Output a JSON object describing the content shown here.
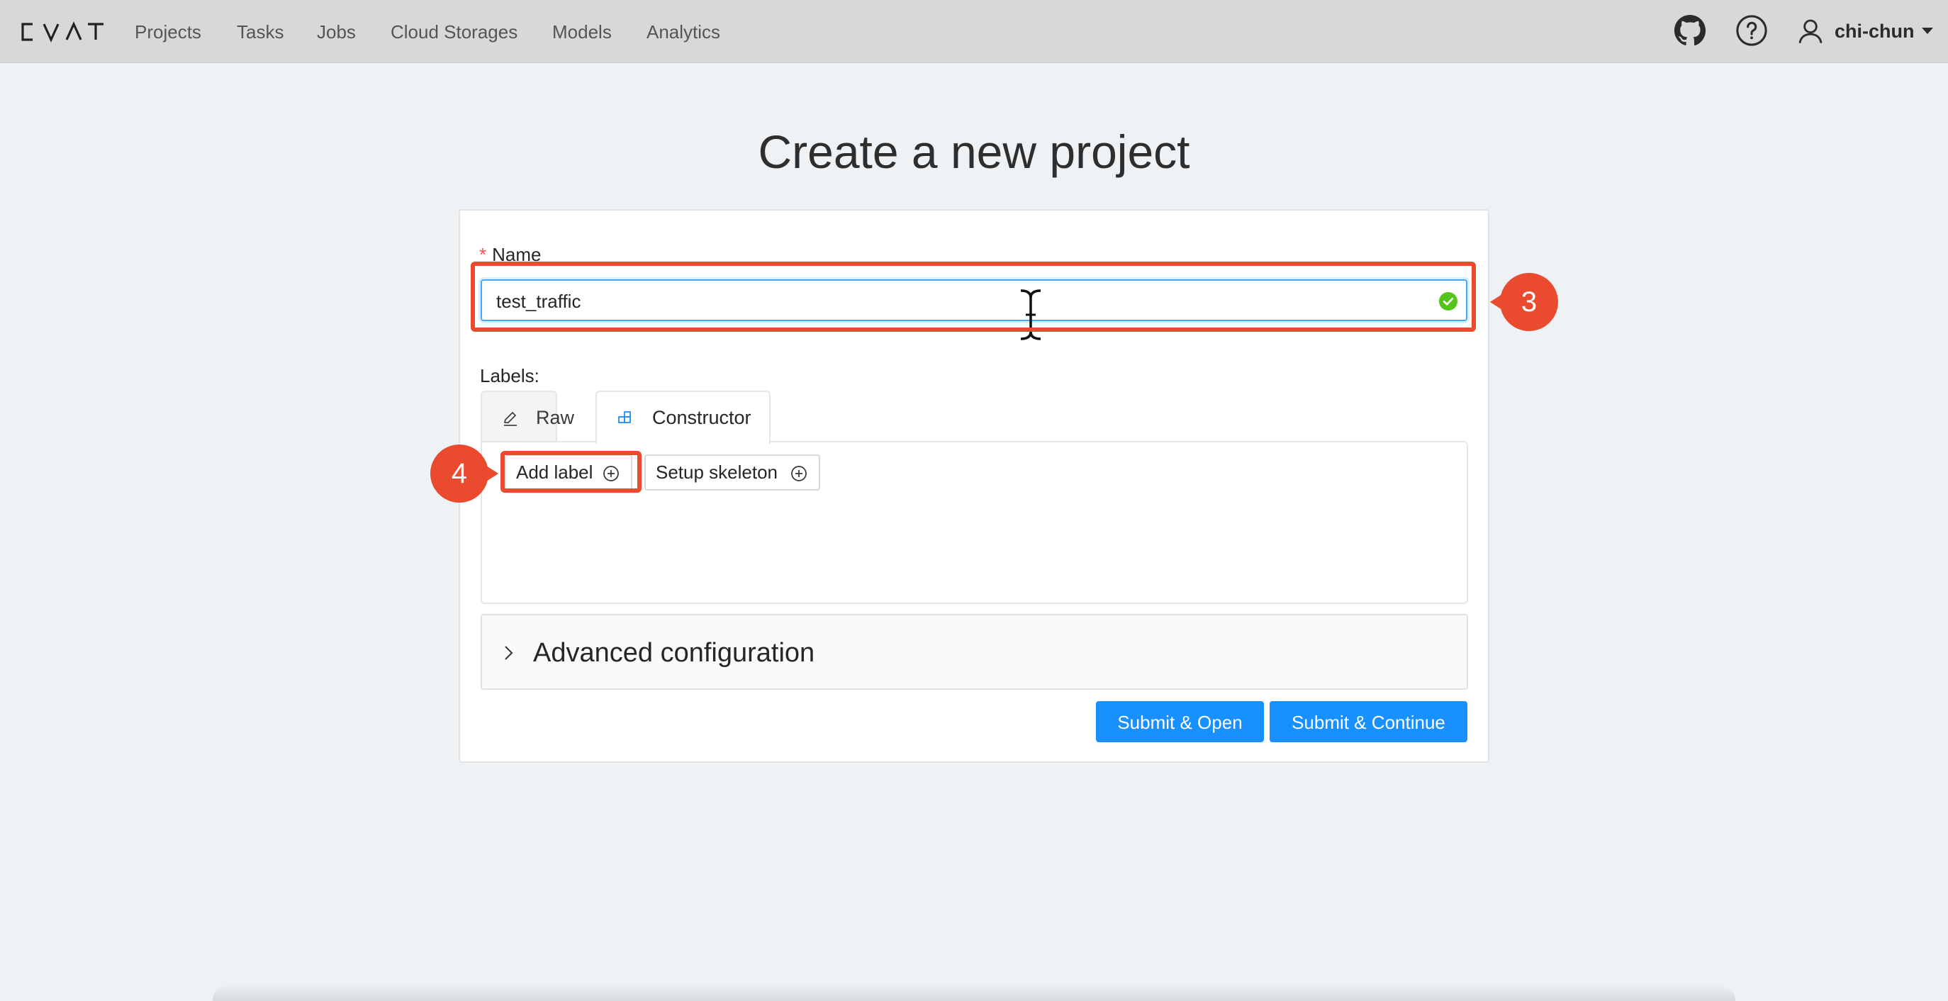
{
  "app": {
    "logo_text": "CVAT"
  },
  "nav": {
    "items": [
      {
        "label": "Projects"
      },
      {
        "label": "Tasks"
      },
      {
        "label": "Jobs"
      },
      {
        "label": "Cloud Storages"
      },
      {
        "label": "Models"
      },
      {
        "label": "Analytics"
      }
    ]
  },
  "header": {
    "icons": [
      "github-icon",
      "help-icon",
      "user-icon"
    ],
    "user_name": "chi-chun"
  },
  "page": {
    "title": "Create a new project"
  },
  "form": {
    "name_label": "Name",
    "required_mark": "*",
    "name_value": "test_traffic",
    "name_status": "valid",
    "labels_caption": "Labels:",
    "tabs": [
      {
        "label": "Raw",
        "icon": "edit-icon",
        "active": false
      },
      {
        "label": "Constructor",
        "icon": "build-icon",
        "active": true
      }
    ],
    "add_label_button": "Add label",
    "setup_skeleton_button": "Setup skeleton",
    "advanced_label": "Advanced configuration",
    "submit_open_button": "Submit & Open",
    "submit_continue_button": "Submit & Continue"
  },
  "annotations": {
    "step_3": "3",
    "step_4": "4"
  },
  "colors": {
    "primary": "#1890ff",
    "highlight": "#ea4a2e",
    "success": "#52c41a",
    "required": "#ff4d4f"
  }
}
